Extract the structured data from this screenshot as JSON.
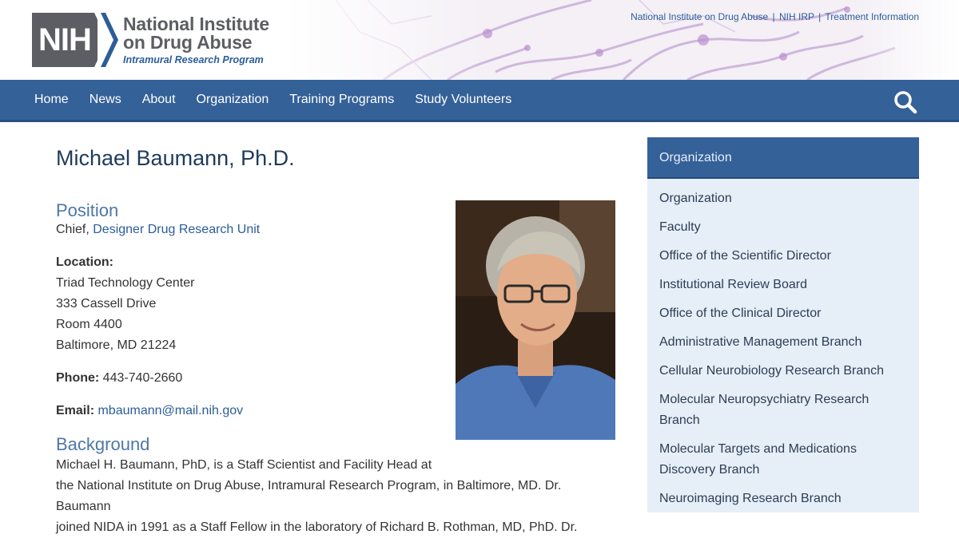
{
  "header": {
    "logo": {
      "mark": "NIH",
      "line1": "National Institute",
      "line2": "on Drug Abuse",
      "line3": "Intramural Research Program"
    },
    "util_links": [
      {
        "label": "National Institute on Drug Abuse"
      },
      {
        "label": "NIH IRP"
      },
      {
        "label": "Treatment Information"
      }
    ],
    "separator": "|"
  },
  "nav": {
    "items": [
      {
        "label": "Home"
      },
      {
        "label": "News"
      },
      {
        "label": "About"
      },
      {
        "label": "Organization"
      },
      {
        "label": "Training Programs"
      },
      {
        "label": "Study Volunteers"
      }
    ],
    "search_icon": "search-icon"
  },
  "profile": {
    "name": "Michael Baumann, Ph.D.",
    "position_heading": "Position",
    "position_prefix": "Chief,",
    "position_link": "Designer Drug Research Unit",
    "location_label": "Location:",
    "location_lines": [
      "Triad Technology Center",
      "333 Cassell Drive",
      "Room 4400",
      "Baltimore, MD 21224"
    ],
    "phone_label": "Phone:",
    "phone": "443-740-2660",
    "email_label": "Email:",
    "email": "mbaumann@mail.nih.gov",
    "background_heading": "Background",
    "background_lines": [
      "Michael H. Baumann, PhD, is a Staff Scientist and Facility Head at",
      "the National Institute on Drug Abuse, Intramural Research Program, in Baltimore, MD. Dr. Baumann",
      "joined NIDA in 1991 as a Staff Fellow in the laboratory of Richard B. Rothman, MD, PhD. Dr."
    ]
  },
  "sidebar": {
    "heading": "Organization",
    "items": [
      {
        "label": "Organization"
      },
      {
        "label": "Faculty"
      },
      {
        "label": "Office of the Scientific Director"
      },
      {
        "label": "Institutional Review Board"
      },
      {
        "label": "Office of the Clinical Director"
      },
      {
        "label": "Administrative Management Branch"
      },
      {
        "label": "Cellular Neurobiology Research Branch"
      },
      {
        "label": "Molecular Neuropsychiatry Research Branch"
      },
      {
        "label": "Molecular Targets and Medications Discovery Branch"
      },
      {
        "label": "Neuroimaging Research Branch"
      }
    ]
  },
  "colors": {
    "nav_bg": "#356199",
    "heading_blue": "#4e77a6",
    "link_blue": "#2b5d99",
    "sidebar_bg": "#e6eef7"
  }
}
